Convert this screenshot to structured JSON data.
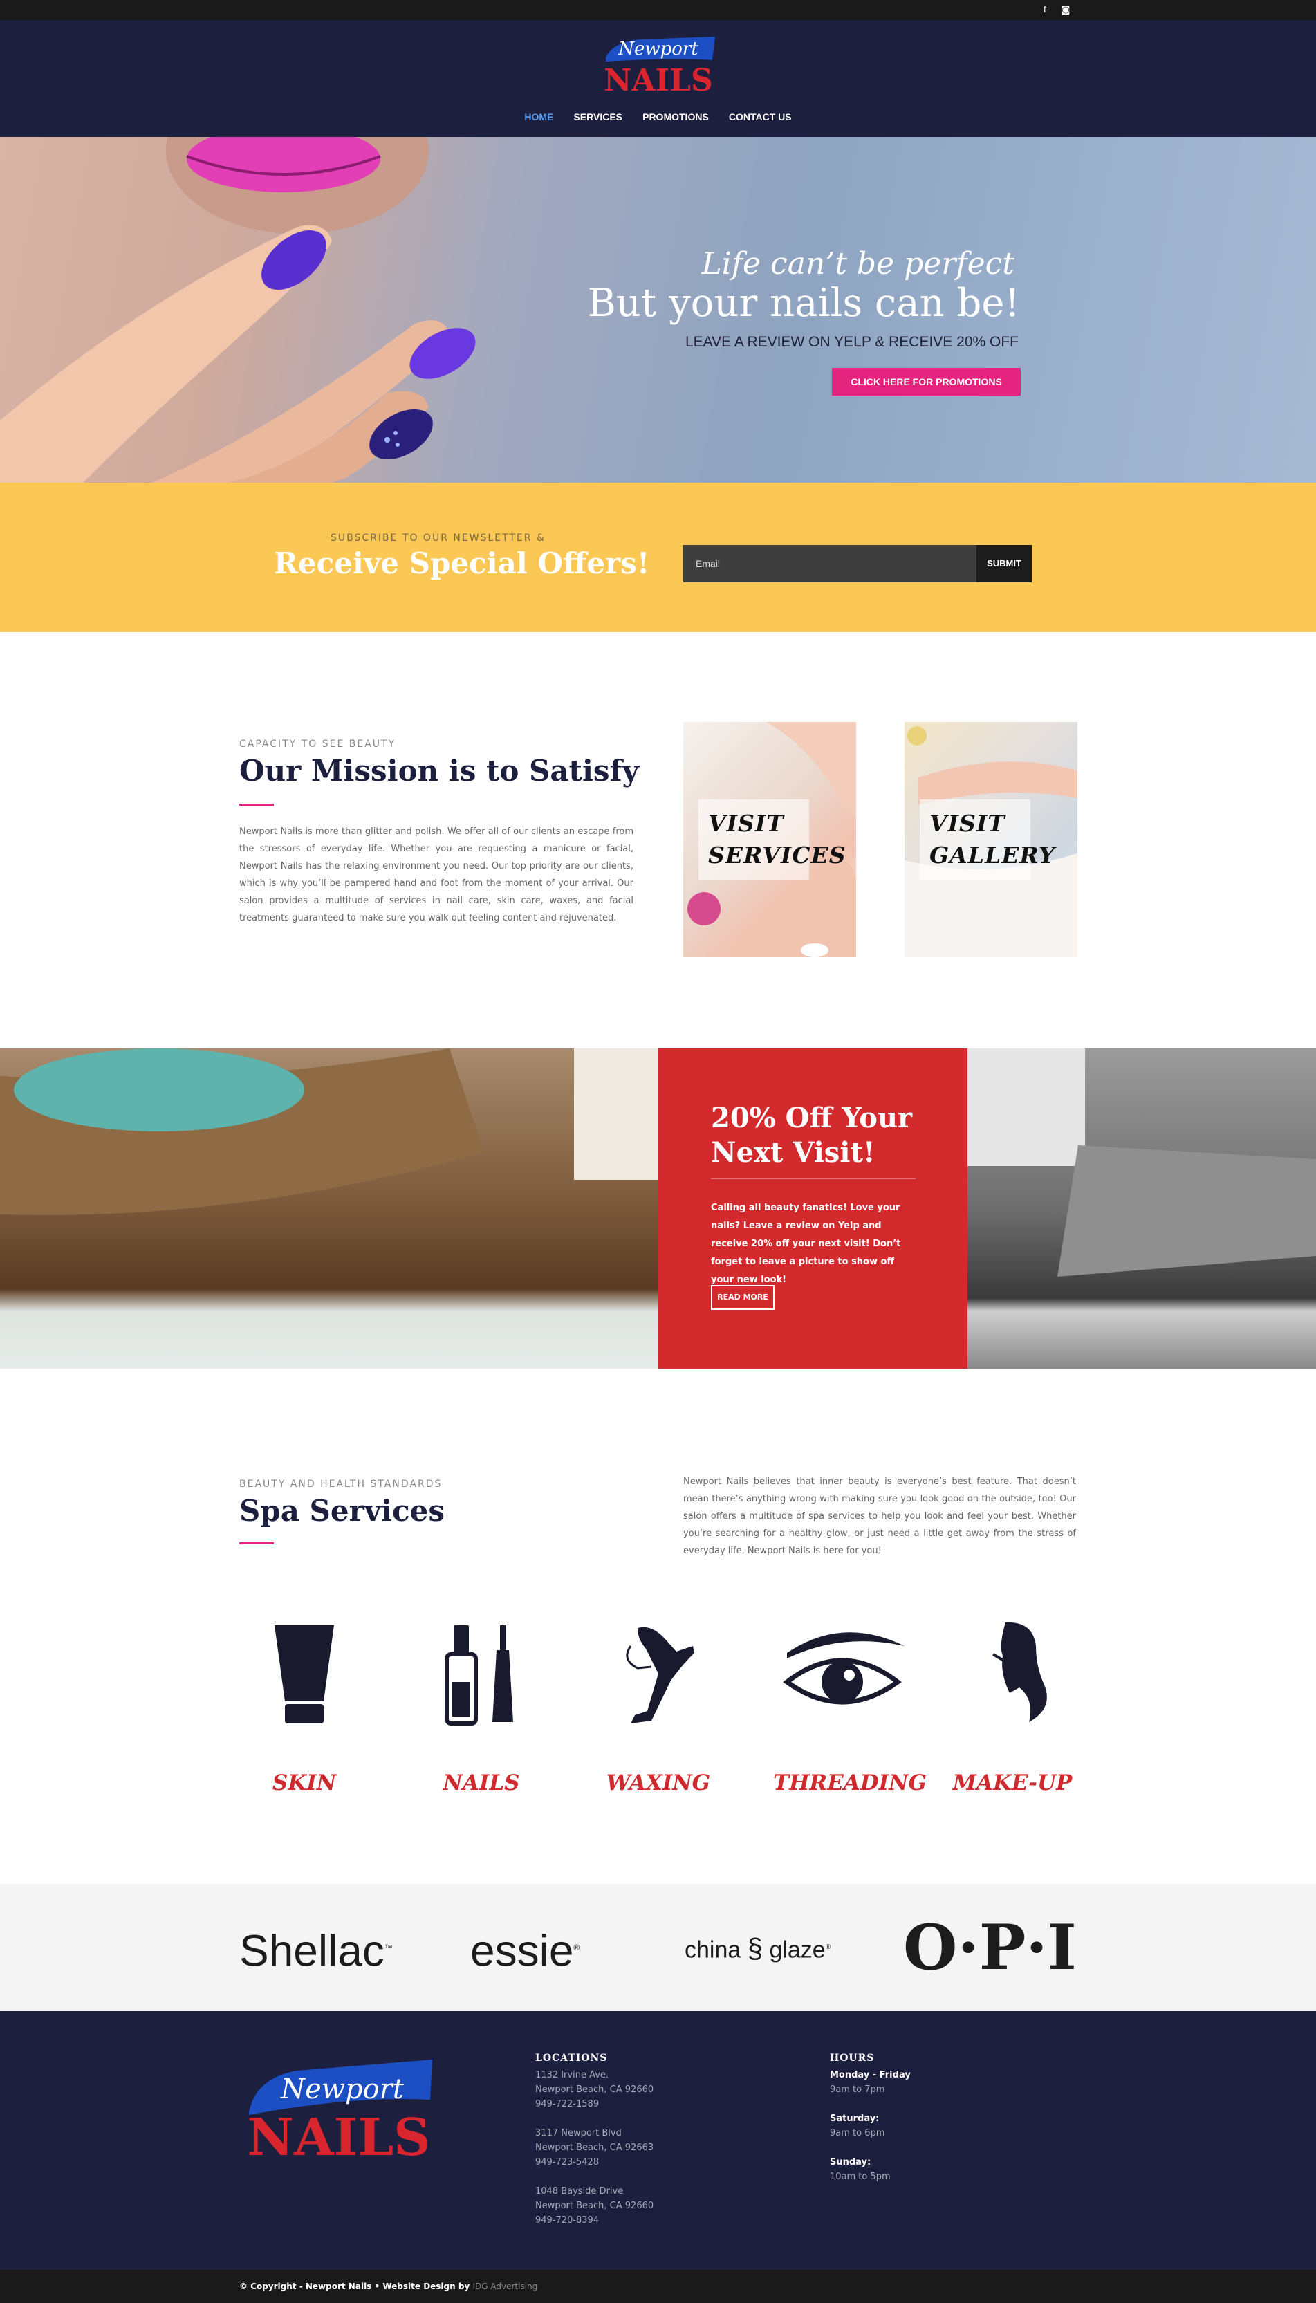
{
  "social": {
    "facebook_icon": "f",
    "instagram_icon": "◙"
  },
  "logo": {
    "script": "Newport",
    "word": "NAILS"
  },
  "nav": {
    "items": [
      {
        "label": "HOME",
        "active": true
      },
      {
        "label": "SERVICES"
      },
      {
        "label": "PROMOTIONS"
      },
      {
        "label": "CONTACT US"
      }
    ]
  },
  "hero": {
    "line1": "Life can’t be perfect",
    "line2": "But your nails can be!",
    "line3": "LEAVE A REVIEW ON YELP & RECEIVE 20% OFF",
    "button": "CLICK HERE FOR PROMOTIONS"
  },
  "newsletter": {
    "kicker": "SUBSCRIBE TO OUR NEWSLETTER &",
    "title": "Receive Special Offers!",
    "placeholder": "Email",
    "submit": "SUBMIT"
  },
  "mission": {
    "kicker": "CAPACITY TO SEE BEAUTY",
    "title": "Our Mission is to Satisfy",
    "text": "Newport Nails is more than glitter and polish. We offer all of our clients an escape from the stressors of everyday life. Whether you are requesting a manicure or facial, Newport Nails has the relaxing environment you need. Our top priority are our clients, which is why you’ll be pampered hand and foot from the moment of your arrival. Our salon provides a multitude of services in nail care, skin care, waxes, and facial treatments guaranteed to make sure you walk out feeling content and rejuvenated.",
    "tile_services": "Visit Services",
    "tile_gallery": "Visit Gallery"
  },
  "promo": {
    "title": "20% Off Your Next Visit!",
    "text": "Calling all beauty fanatics! Love your nails? Leave a review on Yelp and receive 20% off your next visit! Don’t forget to leave a picture to show off your new look!",
    "button": "READ MORE"
  },
  "spa": {
    "kicker": "BEAUTY AND HEALTH STANDARDS",
    "title": "Spa Services",
    "text": "Newport Nails believes that inner beauty is everyone’s best feature. That doesn’t mean there’s anything wrong with making sure you look good on the outside, too! Our salon offers a multitude of spa services to help you look and feel your best. Whether you’re searching for a healthy glow, or just need a little get away from the stress of everyday life, Newport Nails is here for you!",
    "services": [
      {
        "label": "SKIN",
        "icon": "lotion-tube-icon"
      },
      {
        "label": "NAILS",
        "icon": "nail-polish-icon"
      },
      {
        "label": "WAXING",
        "icon": "leg-wax-icon"
      },
      {
        "label": "THREADING",
        "icon": "eye-lash-icon"
      },
      {
        "label": "MAKE-UP",
        "icon": "makeup-face-icon"
      }
    ]
  },
  "brands": {
    "shellac": "Shellac",
    "shellac_tm": "™",
    "essie": "essie",
    "essie_r": "®",
    "china": "china",
    "glaze": "glaze",
    "glaze_r": "®",
    "opi": "O·P·I"
  },
  "footer": {
    "locations_title": "LOCATIONS",
    "locations": [
      [
        "1132 Irvine Ave.",
        "Newport Beach, CA 92660",
        "949-722-1589"
      ],
      [
        "3117 Newport Blvd",
        "Newport Beach, CA 92663",
        "949-723-5428"
      ],
      [
        "1048 Bayside Drive",
        "Newport Beach, CA 92660",
        "949-720-8394"
      ]
    ],
    "hours_title": "HOURS",
    "hours": [
      {
        "day": "Monday - Friday",
        "time": "9am to 7pm"
      },
      {
        "day": "Saturday:",
        "time": "9am to 6pm"
      },
      {
        "day": "Sunday:",
        "time": "10am to 5pm"
      }
    ],
    "copyright": "© Copyright - Newport Nails • Website Design by",
    "agency": "IDG Advertising"
  },
  "colors": {
    "navy": "#1c1f3e",
    "pink": "#e3237d",
    "yellow": "#fbc755",
    "red": "#d32a2e",
    "nav_active": "#5b9ef0"
  }
}
